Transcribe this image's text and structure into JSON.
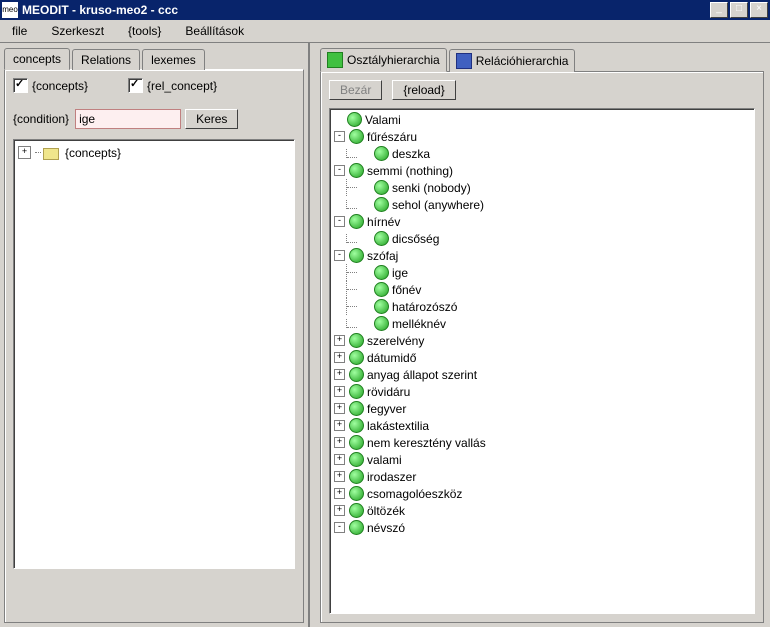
{
  "window": {
    "app_icon": "meo",
    "title": "MEODIT - kruso-meo2 - ccc"
  },
  "menu": {
    "file": "file",
    "szerkeszt": "Szerkeszt",
    "tools": "{tools}",
    "beallitasok": "Beállítások"
  },
  "left": {
    "tabs": {
      "concepts": "concepts",
      "relations": "Relations",
      "lexemes": "lexemes"
    },
    "check_concepts": "{concepts}",
    "check_rel_concept": "{rel_concept}",
    "condition_label": "{condition}",
    "condition_value": "ige",
    "keres": "Keres",
    "root": "{concepts}"
  },
  "right": {
    "tabs": {
      "osztaly": "Osztályhierarchia",
      "relacio": "Relációhierarchia"
    },
    "bezar": "Bezár",
    "reload": "{reload}",
    "tree": [
      {
        "d": 0,
        "exp": "",
        "label": "Valami"
      },
      {
        "d": 0,
        "exp": "-",
        "label": "fűrészáru"
      },
      {
        "d": 1,
        "exp": "",
        "label": "deszka",
        "last": true
      },
      {
        "d": 0,
        "exp": "-",
        "label": "semmi (nothing)"
      },
      {
        "d": 1,
        "exp": "",
        "label": "senki (nobody)"
      },
      {
        "d": 1,
        "exp": "",
        "label": "sehol (anywhere)",
        "last": true
      },
      {
        "d": 0,
        "exp": "-",
        "label": "hírnév"
      },
      {
        "d": 1,
        "exp": "",
        "label": "dicsőség",
        "last": true
      },
      {
        "d": 0,
        "exp": "-",
        "label": "szófaj"
      },
      {
        "d": 1,
        "exp": "",
        "label": "ige"
      },
      {
        "d": 1,
        "exp": "",
        "label": "főnév"
      },
      {
        "d": 1,
        "exp": "",
        "label": "határozószó"
      },
      {
        "d": 1,
        "exp": "",
        "label": "melléknév",
        "last": true
      },
      {
        "d": 0,
        "exp": "+",
        "label": "szerelvény"
      },
      {
        "d": 0,
        "exp": "+",
        "label": "dátumidő"
      },
      {
        "d": 0,
        "exp": "+",
        "label": "anyag állapot szerint"
      },
      {
        "d": 0,
        "exp": "+",
        "label": "rövidáru"
      },
      {
        "d": 0,
        "exp": "+",
        "label": "fegyver"
      },
      {
        "d": 0,
        "exp": "+",
        "label": "lakástextilia"
      },
      {
        "d": 0,
        "exp": "+",
        "label": "nem keresztény vallás"
      },
      {
        "d": 0,
        "exp": "+",
        "label": "valami"
      },
      {
        "d": 0,
        "exp": "+",
        "label": "irodaszer"
      },
      {
        "d": 0,
        "exp": "+",
        "label": "csomagolóeszköz"
      },
      {
        "d": 0,
        "exp": "+",
        "label": "öltözék"
      },
      {
        "d": 0,
        "exp": "-",
        "label": "névszó"
      }
    ]
  }
}
